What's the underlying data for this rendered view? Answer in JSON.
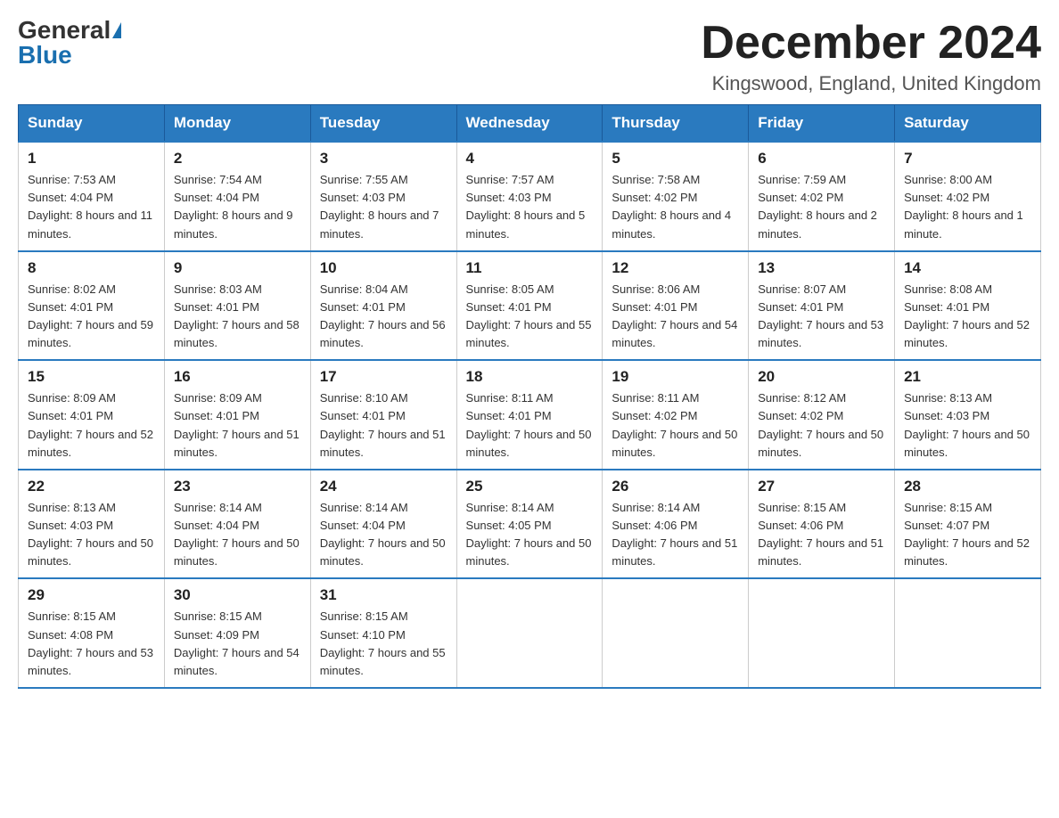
{
  "header": {
    "logo_general": "General",
    "logo_blue": "Blue",
    "month_title": "December 2024",
    "location": "Kingswood, England, United Kingdom"
  },
  "days_of_week": [
    "Sunday",
    "Monday",
    "Tuesday",
    "Wednesday",
    "Thursday",
    "Friday",
    "Saturday"
  ],
  "weeks": [
    [
      {
        "day": "1",
        "sunrise": "Sunrise: 7:53 AM",
        "sunset": "Sunset: 4:04 PM",
        "daylight": "Daylight: 8 hours and 11 minutes."
      },
      {
        "day": "2",
        "sunrise": "Sunrise: 7:54 AM",
        "sunset": "Sunset: 4:04 PM",
        "daylight": "Daylight: 8 hours and 9 minutes."
      },
      {
        "day": "3",
        "sunrise": "Sunrise: 7:55 AM",
        "sunset": "Sunset: 4:03 PM",
        "daylight": "Daylight: 8 hours and 7 minutes."
      },
      {
        "day": "4",
        "sunrise": "Sunrise: 7:57 AM",
        "sunset": "Sunset: 4:03 PM",
        "daylight": "Daylight: 8 hours and 5 minutes."
      },
      {
        "day": "5",
        "sunrise": "Sunrise: 7:58 AM",
        "sunset": "Sunset: 4:02 PM",
        "daylight": "Daylight: 8 hours and 4 minutes."
      },
      {
        "day": "6",
        "sunrise": "Sunrise: 7:59 AM",
        "sunset": "Sunset: 4:02 PM",
        "daylight": "Daylight: 8 hours and 2 minutes."
      },
      {
        "day": "7",
        "sunrise": "Sunrise: 8:00 AM",
        "sunset": "Sunset: 4:02 PM",
        "daylight": "Daylight: 8 hours and 1 minute."
      }
    ],
    [
      {
        "day": "8",
        "sunrise": "Sunrise: 8:02 AM",
        "sunset": "Sunset: 4:01 PM",
        "daylight": "Daylight: 7 hours and 59 minutes."
      },
      {
        "day": "9",
        "sunrise": "Sunrise: 8:03 AM",
        "sunset": "Sunset: 4:01 PM",
        "daylight": "Daylight: 7 hours and 58 minutes."
      },
      {
        "day": "10",
        "sunrise": "Sunrise: 8:04 AM",
        "sunset": "Sunset: 4:01 PM",
        "daylight": "Daylight: 7 hours and 56 minutes."
      },
      {
        "day": "11",
        "sunrise": "Sunrise: 8:05 AM",
        "sunset": "Sunset: 4:01 PM",
        "daylight": "Daylight: 7 hours and 55 minutes."
      },
      {
        "day": "12",
        "sunrise": "Sunrise: 8:06 AM",
        "sunset": "Sunset: 4:01 PM",
        "daylight": "Daylight: 7 hours and 54 minutes."
      },
      {
        "day": "13",
        "sunrise": "Sunrise: 8:07 AM",
        "sunset": "Sunset: 4:01 PM",
        "daylight": "Daylight: 7 hours and 53 minutes."
      },
      {
        "day": "14",
        "sunrise": "Sunrise: 8:08 AM",
        "sunset": "Sunset: 4:01 PM",
        "daylight": "Daylight: 7 hours and 52 minutes."
      }
    ],
    [
      {
        "day": "15",
        "sunrise": "Sunrise: 8:09 AM",
        "sunset": "Sunset: 4:01 PM",
        "daylight": "Daylight: 7 hours and 52 minutes."
      },
      {
        "day": "16",
        "sunrise": "Sunrise: 8:09 AM",
        "sunset": "Sunset: 4:01 PM",
        "daylight": "Daylight: 7 hours and 51 minutes."
      },
      {
        "day": "17",
        "sunrise": "Sunrise: 8:10 AM",
        "sunset": "Sunset: 4:01 PM",
        "daylight": "Daylight: 7 hours and 51 minutes."
      },
      {
        "day": "18",
        "sunrise": "Sunrise: 8:11 AM",
        "sunset": "Sunset: 4:01 PM",
        "daylight": "Daylight: 7 hours and 50 minutes."
      },
      {
        "day": "19",
        "sunrise": "Sunrise: 8:11 AM",
        "sunset": "Sunset: 4:02 PM",
        "daylight": "Daylight: 7 hours and 50 minutes."
      },
      {
        "day": "20",
        "sunrise": "Sunrise: 8:12 AM",
        "sunset": "Sunset: 4:02 PM",
        "daylight": "Daylight: 7 hours and 50 minutes."
      },
      {
        "day": "21",
        "sunrise": "Sunrise: 8:13 AM",
        "sunset": "Sunset: 4:03 PM",
        "daylight": "Daylight: 7 hours and 50 minutes."
      }
    ],
    [
      {
        "day": "22",
        "sunrise": "Sunrise: 8:13 AM",
        "sunset": "Sunset: 4:03 PM",
        "daylight": "Daylight: 7 hours and 50 minutes."
      },
      {
        "day": "23",
        "sunrise": "Sunrise: 8:14 AM",
        "sunset": "Sunset: 4:04 PM",
        "daylight": "Daylight: 7 hours and 50 minutes."
      },
      {
        "day": "24",
        "sunrise": "Sunrise: 8:14 AM",
        "sunset": "Sunset: 4:04 PM",
        "daylight": "Daylight: 7 hours and 50 minutes."
      },
      {
        "day": "25",
        "sunrise": "Sunrise: 8:14 AM",
        "sunset": "Sunset: 4:05 PM",
        "daylight": "Daylight: 7 hours and 50 minutes."
      },
      {
        "day": "26",
        "sunrise": "Sunrise: 8:14 AM",
        "sunset": "Sunset: 4:06 PM",
        "daylight": "Daylight: 7 hours and 51 minutes."
      },
      {
        "day": "27",
        "sunrise": "Sunrise: 8:15 AM",
        "sunset": "Sunset: 4:06 PM",
        "daylight": "Daylight: 7 hours and 51 minutes."
      },
      {
        "day": "28",
        "sunrise": "Sunrise: 8:15 AM",
        "sunset": "Sunset: 4:07 PM",
        "daylight": "Daylight: 7 hours and 52 minutes."
      }
    ],
    [
      {
        "day": "29",
        "sunrise": "Sunrise: 8:15 AM",
        "sunset": "Sunset: 4:08 PM",
        "daylight": "Daylight: 7 hours and 53 minutes."
      },
      {
        "day": "30",
        "sunrise": "Sunrise: 8:15 AM",
        "sunset": "Sunset: 4:09 PM",
        "daylight": "Daylight: 7 hours and 54 minutes."
      },
      {
        "day": "31",
        "sunrise": "Sunrise: 8:15 AM",
        "sunset": "Sunset: 4:10 PM",
        "daylight": "Daylight: 7 hours and 55 minutes."
      },
      null,
      null,
      null,
      null
    ]
  ]
}
